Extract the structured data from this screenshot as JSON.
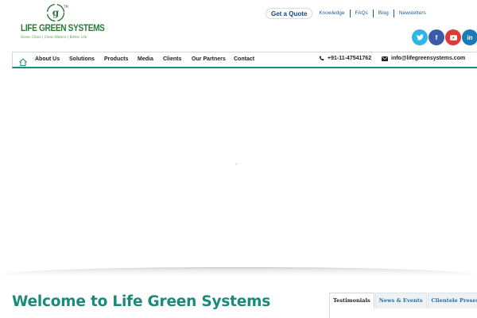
{
  "brand": {
    "logo_letter": "g",
    "trademark": "TM",
    "name": "LIFE GREEN SYSTEMS",
    "tagline": "Green Cities | Clean Waters | Better Life"
  },
  "header": {
    "quote_button": "Get a Quote",
    "links": [
      "Knowledge",
      "FAQs",
      "Blog",
      "Newsletters"
    ]
  },
  "social": [
    {
      "name": "twitter",
      "glyph": "t",
      "color": "#2fb6e6"
    },
    {
      "name": "facebook",
      "glyph": "f",
      "color": "#3a5ba8"
    },
    {
      "name": "youtube",
      "glyph": "▶",
      "color": "#dd3b35"
    },
    {
      "name": "linkedin",
      "glyph": "in",
      "color": "#1c7bb7"
    }
  ],
  "nav": {
    "home_icon": "home-icon",
    "items": [
      "About Us",
      "Solutions",
      "Products",
      "Media",
      "Clients",
      "Our Partners",
      "Contact"
    ],
    "phone": "+91-11-47541762",
    "email": "info@lifegreensystems.com"
  },
  "main": {
    "welcome_title": "Welcome to Life Green Systems"
  },
  "tabs": [
    "Testimonials",
    "News & Events",
    "Clientele Presence"
  ],
  "colors": {
    "accent": "#1a8a7a",
    "brand_green": "#2c7a35",
    "link_blue": "#1e5d9a"
  }
}
